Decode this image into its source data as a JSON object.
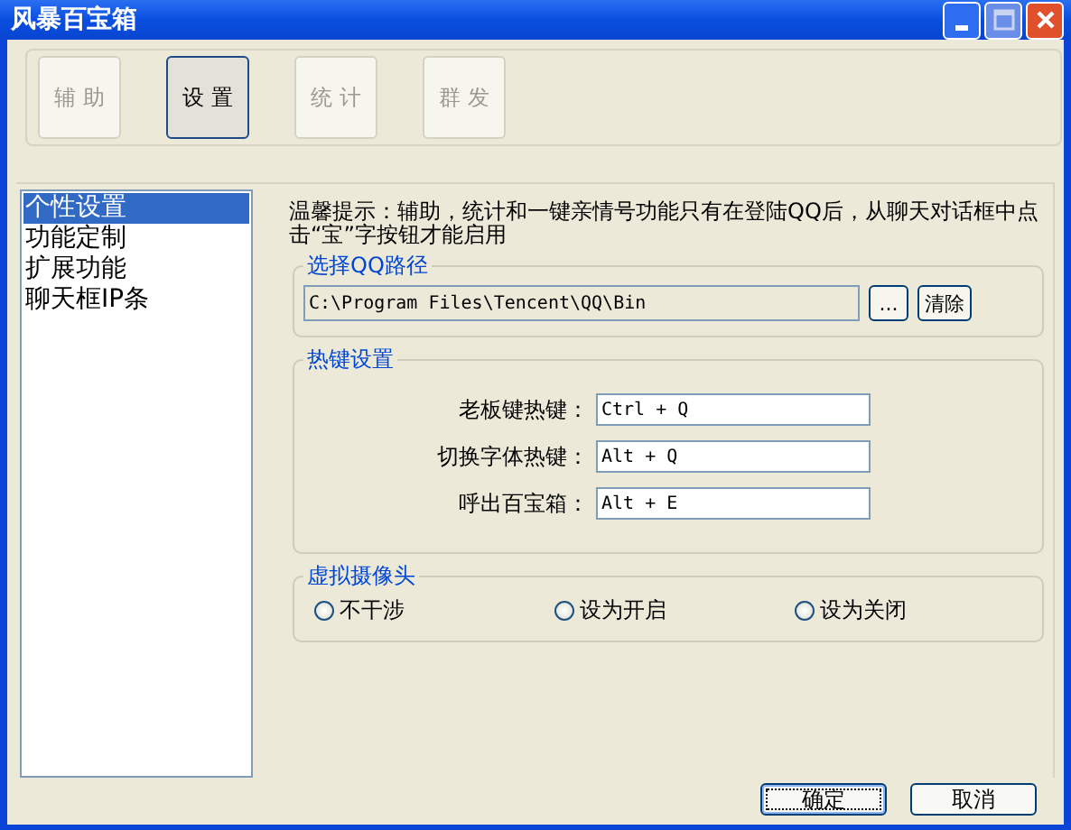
{
  "window": {
    "title": "风暴百宝箱"
  },
  "tabs": [
    {
      "label": "辅 助",
      "selected": false
    },
    {
      "label": "设 置",
      "selected": true
    },
    {
      "label": "统 计",
      "selected": false
    },
    {
      "label": "群 发",
      "selected": false
    }
  ],
  "sidebar": {
    "items": [
      {
        "label": "个性设置",
        "selected": true
      },
      {
        "label": "功能定制",
        "selected": false
      },
      {
        "label": "扩展功能",
        "selected": false
      },
      {
        "label": "聊天框IP条",
        "selected": false
      }
    ]
  },
  "tip": "温馨提示：辅助，统计和一键亲情号功能只有在登陆QQ后，从聊天对话框中点击“宝”字按钮才能启用",
  "qq_path": {
    "title": "选择QQ路径",
    "value": "C:\\Program Files\\Tencent\\QQ\\Bin",
    "browse_button": "...",
    "clear_button": "清除"
  },
  "hotkeys": {
    "title": "热键设置",
    "rows": [
      {
        "label": "老板键热键：",
        "value": "Ctrl + Q"
      },
      {
        "label": "切换字体热键：",
        "value": "Alt + Q"
      },
      {
        "label": "呼出百宝箱：",
        "value": "Alt + E"
      }
    ]
  },
  "camera": {
    "title": "虚拟摄像头",
    "options": [
      {
        "label": "不干涉",
        "selected": false
      },
      {
        "label": "设为开启",
        "selected": false
      },
      {
        "label": "设为关闭",
        "selected": false
      }
    ]
  },
  "buttons": [
    {
      "label": "确定",
      "default": true
    },
    {
      "label": "取消",
      "default": false
    }
  ]
}
